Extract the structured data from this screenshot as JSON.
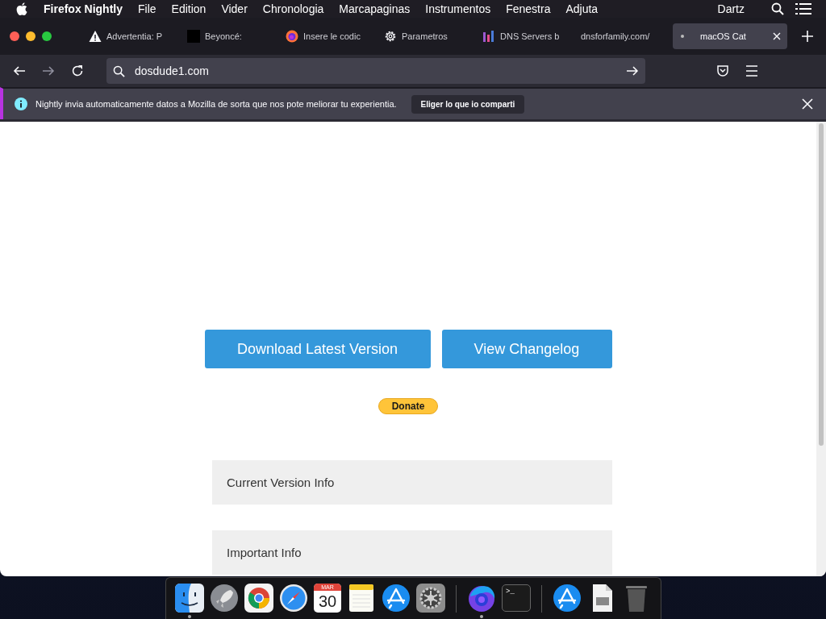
{
  "menu_bar": {
    "app": "Firefox Nightly",
    "items": [
      "File",
      "Edition",
      "Vider",
      "Chronologia",
      "Marcapaginas",
      "Instrumentos",
      "Fenestra",
      "Adjuta"
    ],
    "user": "Dartz"
  },
  "tabs": [
    {
      "label": "Advertentia: P",
      "kind": "warning",
      "selected": false
    },
    {
      "label": "Beyoncé:",
      "kind": "square",
      "selected": false
    },
    {
      "label": "Insere le codic",
      "kind": "firefox",
      "selected": false
    },
    {
      "label": "Parametros",
      "kind": "gear",
      "selected": false
    },
    {
      "label": "DNS Servers b",
      "kind": "bars",
      "selected": false
    },
    {
      "label": "dnsforfamily.com/",
      "kind": "plain",
      "selected": false
    },
    {
      "label": "macOS Cat",
      "kind": "loading",
      "selected": true
    }
  ],
  "address_bar": {
    "value": "dosdude1.com"
  },
  "notification": {
    "message": "Nightly invia automaticamente datos a Mozilla de sorta que nos pote meliorar tu experientia.",
    "button": "Eliger lo que io comparti"
  },
  "page": {
    "buttons": [
      "Download Latest Version",
      "View Changelog"
    ],
    "donate": "Donate",
    "sections": [
      {
        "title": "Current Version Info"
      },
      {
        "title": "Important Info"
      }
    ]
  },
  "dock": {
    "groups": [
      [
        {
          "kind": "finder",
          "running": true
        },
        {
          "kind": "launchpad",
          "running": false
        },
        {
          "kind": "chrome",
          "running": false
        },
        {
          "kind": "safari",
          "running": false
        },
        {
          "kind": "calendar",
          "running": false,
          "month": "MAR",
          "day": "30"
        },
        {
          "kind": "notes",
          "running": false
        },
        {
          "kind": "appstore",
          "running": false
        },
        {
          "kind": "settings",
          "running": false
        }
      ],
      [
        {
          "kind": "firefox",
          "running": true
        },
        {
          "kind": "terminal",
          "running": false,
          "prompt": ">_"
        }
      ],
      [
        {
          "kind": "appstore",
          "running": false
        },
        {
          "kind": "document",
          "running": false
        },
        {
          "kind": "trash",
          "running": false
        }
      ]
    ]
  }
}
